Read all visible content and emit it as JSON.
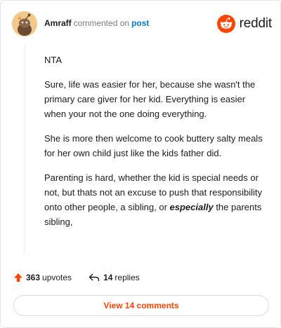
{
  "comment": {
    "author": "Amraff",
    "commented_text": "commented on",
    "post_link": "post",
    "paragraphs": {
      "p1": "NTA",
      "p2": "Sure, life was easier for her, because she wasn't the primary care giver for her kid. Everything is easier when your not the one doing everything.",
      "p3": "She is more then welcome to cook buttery salty meals for her own child just like the kids father did.",
      "p4_before": "Parenting is hard, whether the kid is special needs or not, but thats not an excuse to push that responsibility onto other people, a sibling, or",
      "p4_emphasis": "especially",
      "p4_after": "the parents sibling,"
    }
  },
  "brand": {
    "logo_text": "reddit",
    "accent_color": "#ff4500",
    "link_color": "#0079d3"
  },
  "actions": {
    "upvote_count": "363",
    "upvote_label": "upvotes",
    "reply_count": "14",
    "reply_label": "replies"
  },
  "footer": {
    "view_comments_label": "View 14 comments"
  },
  "icons": {
    "avatar": "snoo-avatar-icon",
    "logo": "reddit-alien-icon",
    "upvote": "upvote-arrow-icon",
    "reply": "reply-arrow-icon"
  }
}
